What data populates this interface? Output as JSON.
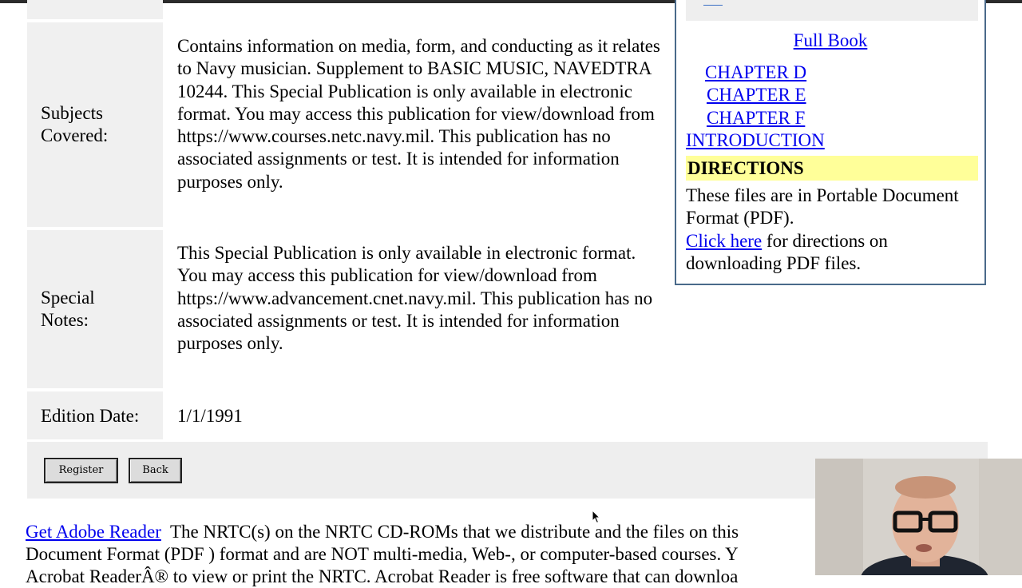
{
  "info_table": {
    "subjects_label": "Subjects\nCovered:",
    "subjects_value": "Contains information on media, form, and conducting as it relates to Navy musician. Supplement to BASIC MUSIC, NAVEDTRA 10244. This Special Publication is only available in electronic format. You may access this publication for view/download from https://www.courses.netc.navy.mil. This publication has no associated assignments or test. It is intended for information purposes only.",
    "notes_label": "Special\nNotes:",
    "notes_value": "This Special Publication is only available in electronic format. You may access this publication for view/download from https://www.advancement.cnet.navy.mil. This publication has no associated assignments or test. It is intended for information purposes only.",
    "edition_label": "Edition Date:",
    "edition_value": "1/1/1991"
  },
  "panel": {
    "full_book": "Full Book",
    "chapters": [
      "CHAPTER D",
      "CHAPTER E",
      "CHAPTER F",
      "INTRODUCTION"
    ],
    "directions_heading": "DIRECTIONS",
    "directions_text_1": "These files are in Portable Document Format (PDF).",
    "click_here": "Click here",
    "directions_text_2": " for directions on downloading PDF files."
  },
  "buttons": {
    "register": "Register",
    "back": "Back"
  },
  "footer": {
    "adobe_link": "Get Adobe Reader",
    "line1": "  The NRTC(s) on the NRTC CD-ROMs that we distribute and the files on this",
    "line2": "Document Format (PDF ) format and are NOT multi-media, Web-, or computer-based courses. Y",
    "line3": "Acrobat ReaderÂ® to view or print the NRTC. Acrobat Reader is free software that can downloa"
  },
  "colors": {
    "link": "#0000ee",
    "directions_highlight": "#ffff99",
    "cell_background": "#f0f0f0",
    "panel_border": "#4a6a8a"
  }
}
